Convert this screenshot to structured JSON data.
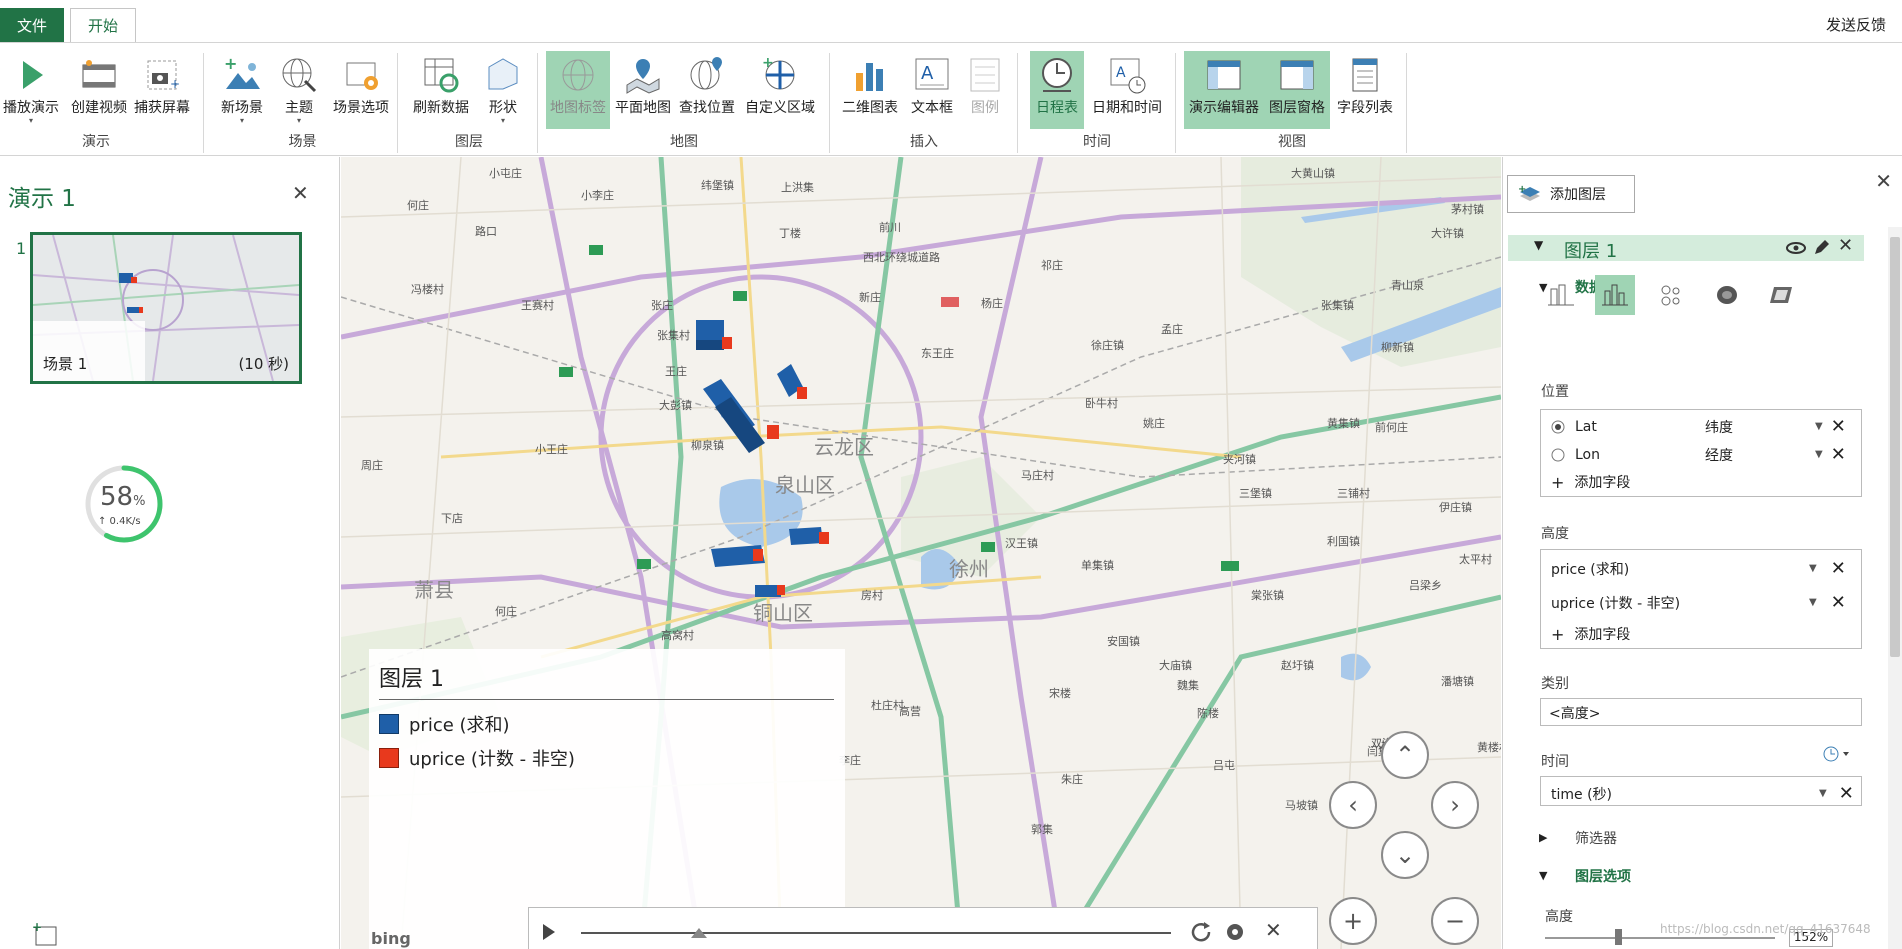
{
  "tabs": {
    "file": "文件",
    "home": "开始",
    "feedback": "发送反馈"
  },
  "ribbon": {
    "groups": {
      "demo": "演示",
      "scene": "场景",
      "layer": "图层",
      "map": "地图",
      "insert": "插入",
      "time": "时间",
      "view": "视图"
    },
    "buttons": {
      "play_tour": "播放演示",
      "create_video": "创建视频",
      "capture_screen": "捕获屏幕",
      "new_scene": "新场景",
      "theme": "主题",
      "scene_options": "场景选项",
      "refresh_data": "刷新数据",
      "shapes": "形状",
      "map_labels": "地图标签",
      "flat_map": "平面地图",
      "find_location": "查找位置",
      "custom_regions": "自定义区域",
      "chart_2d": "二维图表",
      "text_box": "文本框",
      "legend": "图例",
      "timeline": "日程表",
      "date_time": "日期和时间",
      "tour_editor": "演示编辑器",
      "layer_pane": "图层窗格",
      "field_list": "字段列表"
    }
  },
  "tour": {
    "title": "演示 1",
    "close": "✕",
    "scene_index": "1",
    "scene_name": "场景 1",
    "scene_duration": "(10 秒)",
    "speed_percent": "58",
    "speed_unit": "%",
    "speed_rate": "↑ 0.4K/s"
  },
  "map": {
    "labels": [
      "小屯庄",
      "小李庄",
      "纬堡镇",
      "上洪集",
      "路口",
      "何庄",
      "冯楼村",
      "王赛村",
      "张庄",
      "前川",
      "丁楼",
      "西北环绕城道路",
      "新庄",
      "杨庄",
      "东王庄",
      "王庄",
      "柳泉镇",
      "大彭镇",
      "张集村",
      "小王庄",
      "泉山区",
      "云龙区",
      "徐州",
      "铜山区",
      "萧县",
      "下店",
      "周庄",
      "高窝村",
      "杜庄村",
      "何庄",
      "高营",
      "李庄",
      "朱庄",
      "汉王镇",
      "房村",
      "单集镇",
      "大庙镇",
      "三堡镇",
      "棠张镇",
      "利国镇",
      "潘塘镇",
      "双沟镇",
      "黄集镇",
      "张集镇",
      "柳新镇",
      "茅村镇",
      "徐庄镇",
      "夹河镇",
      "三铺村",
      "大许镇",
      "大黄山镇",
      "吕梁乡",
      "伊庄镇",
      "青山泉",
      "赵圩镇",
      "马庄村",
      "卧牛村",
      "太平村",
      "闫集村",
      "前何庄",
      "吕屯",
      "姚庄",
      "安国镇",
      "陈楼",
      "马坡镇",
      "郭集",
      "魏集",
      "宋楼",
      "孟庄",
      "黄楼村",
      "柳集",
      "祁庄"
    ],
    "district_labels": [
      "泉山区",
      "云龙区",
      "徐州",
      "铜山区",
      "萧县"
    ],
    "legend": {
      "title": "图层 1",
      "items": [
        {
          "label": "price (求和)",
          "color": "#1f5fa8"
        },
        {
          "label": "uprice (计数 - 非空)",
          "color": "#e8391d"
        }
      ]
    },
    "logo": "bing",
    "watermark": "https://blog.csdn.net/qq_41637648"
  },
  "layer_pane": {
    "add_layer": "添加图层",
    "close": "✕",
    "layer_name": "图层 1",
    "data_section": "数据",
    "location_label": "位置",
    "location_fields": [
      {
        "field": "Lat",
        "type": "纬度",
        "selected": true
      },
      {
        "field": "Lon",
        "type": "经度",
        "selected": false
      }
    ],
    "add_field": "添加字段",
    "height_label": "高度",
    "height_fields": [
      {
        "field": "price (求和)"
      },
      {
        "field": "uprice (计数 - 非空)"
      }
    ],
    "category_label": "类别",
    "category_value": "<高度>",
    "time_label": "时间",
    "time_value": "time (秒)",
    "filter_label": "筛选器",
    "layer_options_label": "图层选项",
    "height_option_label": "高度",
    "height_option_value": "152%"
  },
  "colors": {
    "accent": "#217346",
    "price": "#1f5fa8",
    "uprice": "#e8391d",
    "toggle_on": "#9fd4b4"
  }
}
